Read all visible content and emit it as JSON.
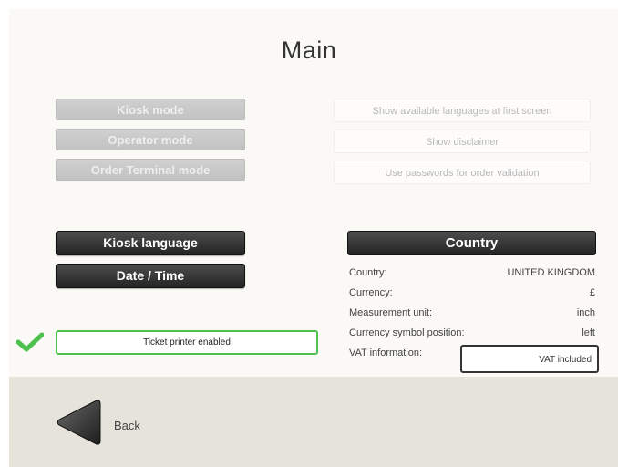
{
  "page": {
    "title": "Main"
  },
  "modes": [
    {
      "label": "Kiosk mode"
    },
    {
      "label": "Operator mode"
    },
    {
      "label": "Order Terminal mode"
    }
  ],
  "options": [
    {
      "label": "Show available languages at first screen"
    },
    {
      "label": "Show disclaimer"
    },
    {
      "label": "Use passwords for order validation"
    }
  ],
  "buttons": {
    "kiosk_language": "Kiosk language",
    "date_time": "Date / Time",
    "country": "Country"
  },
  "country_info": [
    {
      "label": "Country:",
      "value": "UNITED KINGDOM"
    },
    {
      "label": "Currency:",
      "value": "£"
    },
    {
      "label": "Measurement unit:",
      "value": "inch"
    },
    {
      "label": "Currency symbol position:",
      "value": "left"
    },
    {
      "label": "VAT information:",
      "value": "VAT included"
    }
  ],
  "printer": {
    "label": "Ticket printer enabled",
    "enabled": true
  },
  "footer": {
    "back_label": "Back"
  },
  "colors": {
    "accent_green": "#4ec04e",
    "dark_button": "#2e2e2e",
    "disabled_button": "#c8c8c8",
    "footer_bg": "#e6e3db"
  }
}
